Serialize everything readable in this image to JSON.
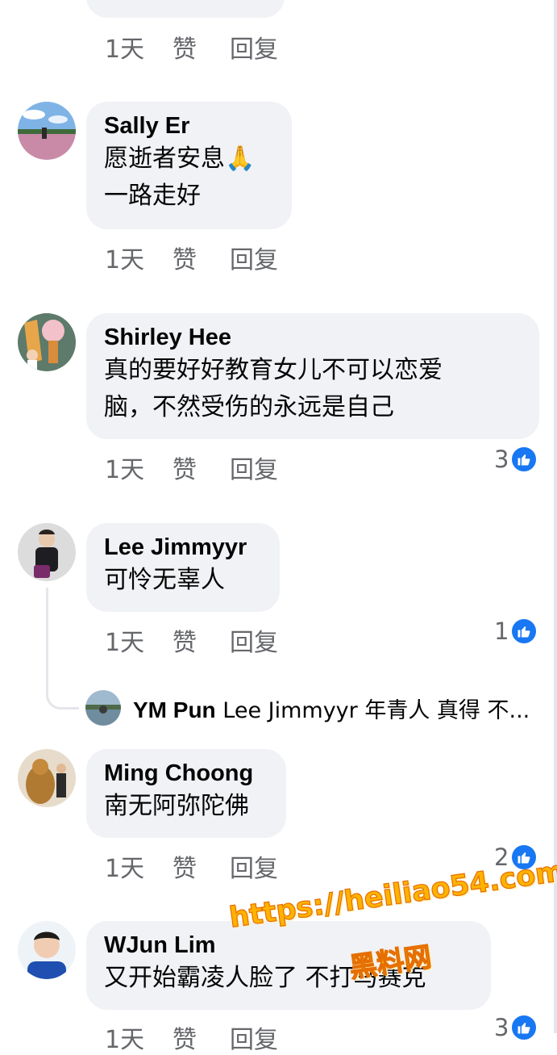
{
  "actions": {
    "time": "1天",
    "like": "赞",
    "reply": "回复"
  },
  "top_partial": {
    "text": "· · ·  · · · · ·"
  },
  "comments": [
    {
      "name": "Sally Er",
      "text": "愿逝者安息🙏\n一路走好",
      "reactions": null
    },
    {
      "name": "Shirley Hee",
      "text": "真的要好好教育女儿不可以恋爱\n脑，不然受伤的永远是自己",
      "reactions": "3"
    },
    {
      "name": "Lee Jimmyyr",
      "text": "可怜无辜人",
      "reactions": "1"
    },
    {
      "name": "Ming Choong",
      "text": "南无阿弥陀佛",
      "reactions": "2"
    },
    {
      "name": "WJun Lim",
      "text": "又开始霸凌人脸了  不打马赛克",
      "reactions": "3"
    }
  ],
  "reply": {
    "name": "YM Pun",
    "text": "Lee Jimmyyr 年青人 真得 不..."
  },
  "watermark": {
    "line1": "https://heiliao54.com",
    "line2": "黑料网"
  },
  "colors": {
    "bubble": "#f0f2f5",
    "muted": "#65676b",
    "like": "#1877f2",
    "watermark": "#ffb300"
  }
}
